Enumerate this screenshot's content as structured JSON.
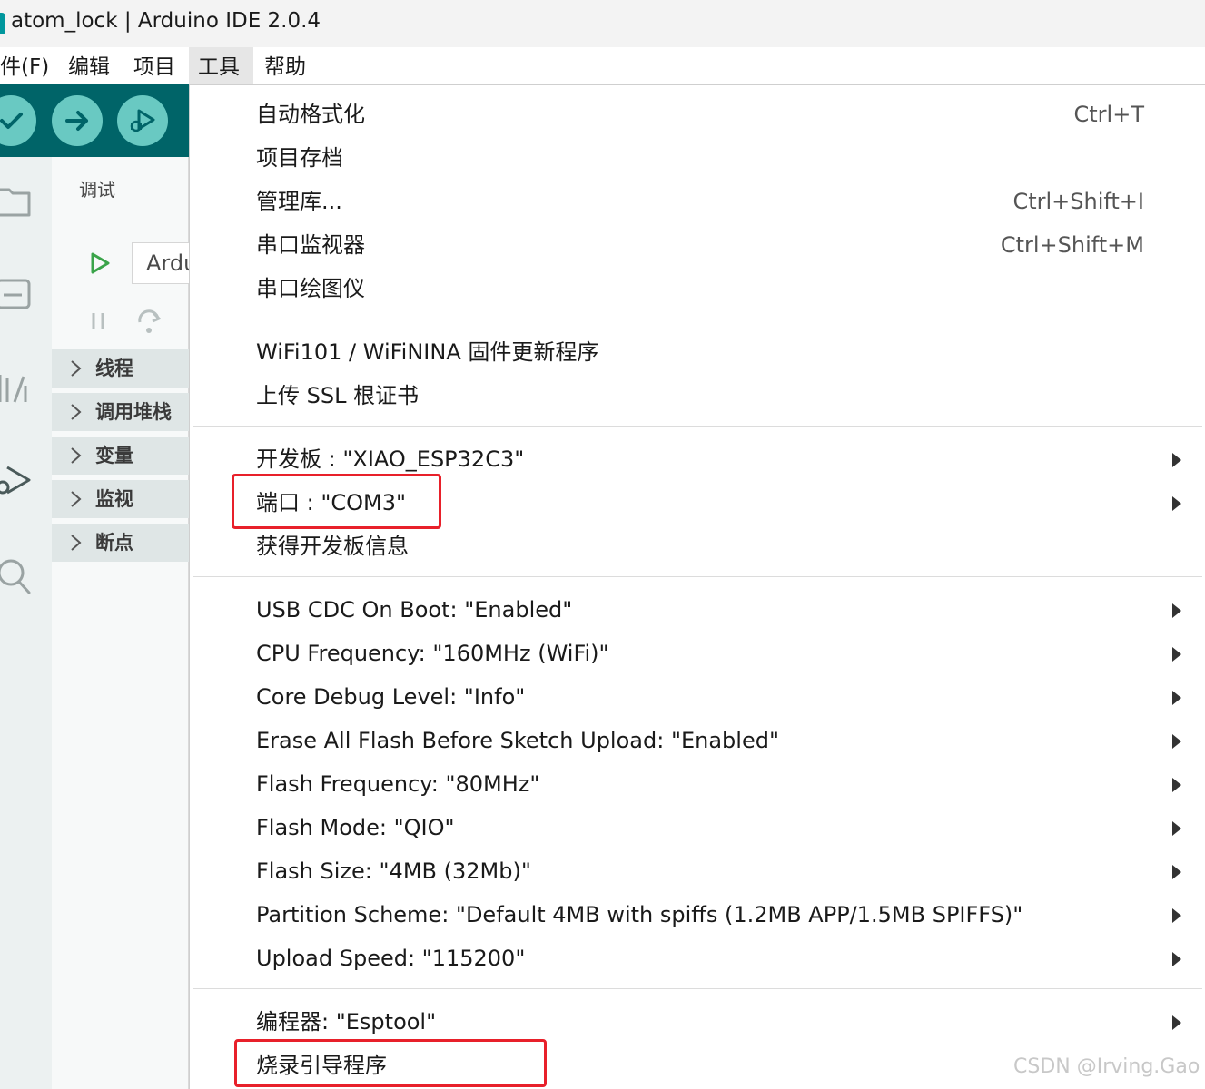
{
  "window": {
    "title": "atom_lock | Arduino IDE 2.0.4"
  },
  "menubar": {
    "items": [
      {
        "label": "件(F)"
      },
      {
        "label": "编辑"
      },
      {
        "label": "项目"
      },
      {
        "label": "工具",
        "active": true
      },
      {
        "label": "帮助"
      }
    ]
  },
  "toolbar": {
    "buttons": [
      "verify-icon",
      "upload-icon",
      "debug-icon"
    ],
    "accent": "#006468",
    "button_color": "#69c9c2"
  },
  "activity_bar": {
    "icons": [
      "sketchbook-folder-icon",
      "boards-manager-icon",
      "library-manager-icon",
      "debug-icon",
      "search-icon"
    ]
  },
  "debug_panel": {
    "title": "调试",
    "config_value": "Ardu",
    "sections": [
      "线程",
      "调用堆栈",
      "变量",
      "监视",
      "断点"
    ]
  },
  "tools_menu": {
    "groups": [
      [
        {
          "label": "自动格式化",
          "shortcut": "Ctrl+T"
        },
        {
          "label": "项目存档",
          "shortcut": ""
        },
        {
          "label": "管理库...",
          "shortcut": "Ctrl+Shift+I"
        },
        {
          "label": "串口监视器",
          "shortcut": "Ctrl+Shift+M"
        },
        {
          "label": "串口绘图仪",
          "shortcut": ""
        }
      ],
      [
        {
          "label": "WiFi101 / WiFiNINA 固件更新程序"
        },
        {
          "label": "上传 SSL 根证书"
        }
      ],
      [
        {
          "label": "开发板 : \"XIAO_ESP32C3\"",
          "submenu": true
        },
        {
          "label": "端口 : \"COM3\"",
          "submenu": true,
          "highlighted": true
        },
        {
          "label": "获得开发板信息"
        }
      ],
      [
        {
          "label": "USB CDC On Boot: \"Enabled\"",
          "submenu": true
        },
        {
          "label": "CPU Frequency: \"160MHz (WiFi)\"",
          "submenu": true
        },
        {
          "label": "Core Debug Level: \"Info\"",
          "submenu": true
        },
        {
          "label": "Erase All Flash Before Sketch Upload: \"Enabled\"",
          "submenu": true
        },
        {
          "label": "Flash Frequency: \"80MHz\"",
          "submenu": true
        },
        {
          "label": "Flash Mode: \"QIO\"",
          "submenu": true
        },
        {
          "label": "Flash Size: \"4MB (32Mb)\"",
          "submenu": true
        },
        {
          "label": "Partition Scheme: \"Default 4MB with spiffs (1.2MB APP/1.5MB SPIFFS)\"",
          "submenu": true
        },
        {
          "label": "Upload Speed: \"115200\"",
          "submenu": true
        }
      ],
      [
        {
          "label": "编程器: \"Esptool\"",
          "submenu": true
        },
        {
          "label": "烧录引导程序",
          "highlighted": true
        }
      ]
    ],
    "highlight_color": "#e8202a"
  },
  "watermark": "CSDN @Irving.Gao"
}
